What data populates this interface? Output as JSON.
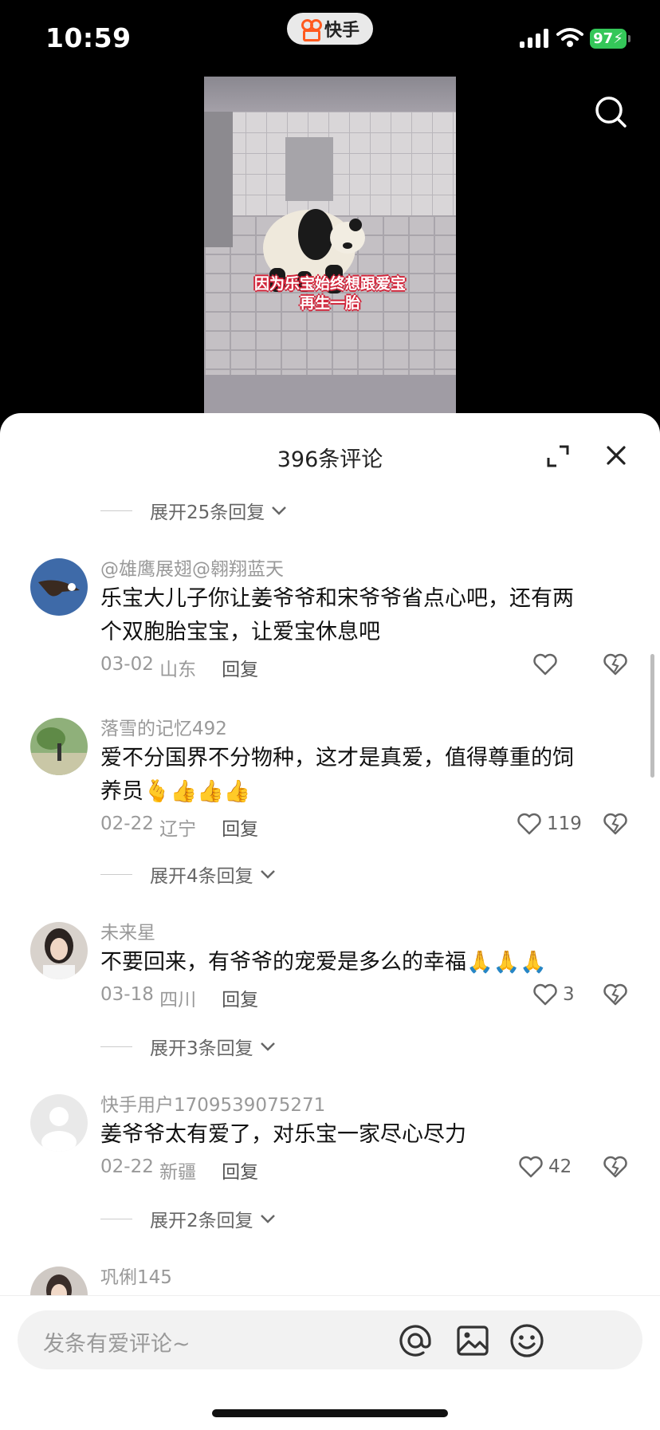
{
  "status": {
    "time": "10:59",
    "battery": "97",
    "app_name": "快手"
  },
  "video": {
    "caption_line1": "因为乐宝始终想跟爱宝",
    "caption_line2": "再生一胎"
  },
  "sheet": {
    "title": "396条评论"
  },
  "comments": [
    {
      "more_replies": "展开25条回复"
    },
    {
      "name": "@雄鹰展翅@翱翔蓝天",
      "text_line1": "乐宝大儿子你让姜爷爷和宋爷爷省点心吧，还有两",
      "text_line2": "个双胞胎宝宝，让爱宝休息吧",
      "date": "03-02",
      "region": "山东",
      "reply": "回复",
      "likes": ""
    },
    {
      "name": "落雪的记忆492",
      "text_line1": "爱不分国界不分物种，这才是真爱，值得尊重的饲",
      "text_line2": "养员🫰👍👍👍",
      "date": "02-22",
      "region": "辽宁",
      "reply": "回复",
      "likes": "119",
      "more_replies": "展开4条回复"
    },
    {
      "name": "未来星",
      "text_line1": "不要回来，有爷爷的宠爱是多么的幸福🙏🙏🙏",
      "date": "03-18",
      "region": "四川",
      "reply": "回复",
      "likes": "3",
      "more_replies": "展开3条回复"
    },
    {
      "name": "快手用户1709539075271",
      "text_line1": "姜爷爷太有爱了，对乐宝一家尽心尽力",
      "date": "02-22",
      "region": "新疆",
      "reply": "回复",
      "likes": "42",
      "more_replies": "展开2条回复"
    },
    {
      "name": "巩俐145"
    }
  ],
  "input": {
    "placeholder": "发条有爱评论~"
  }
}
